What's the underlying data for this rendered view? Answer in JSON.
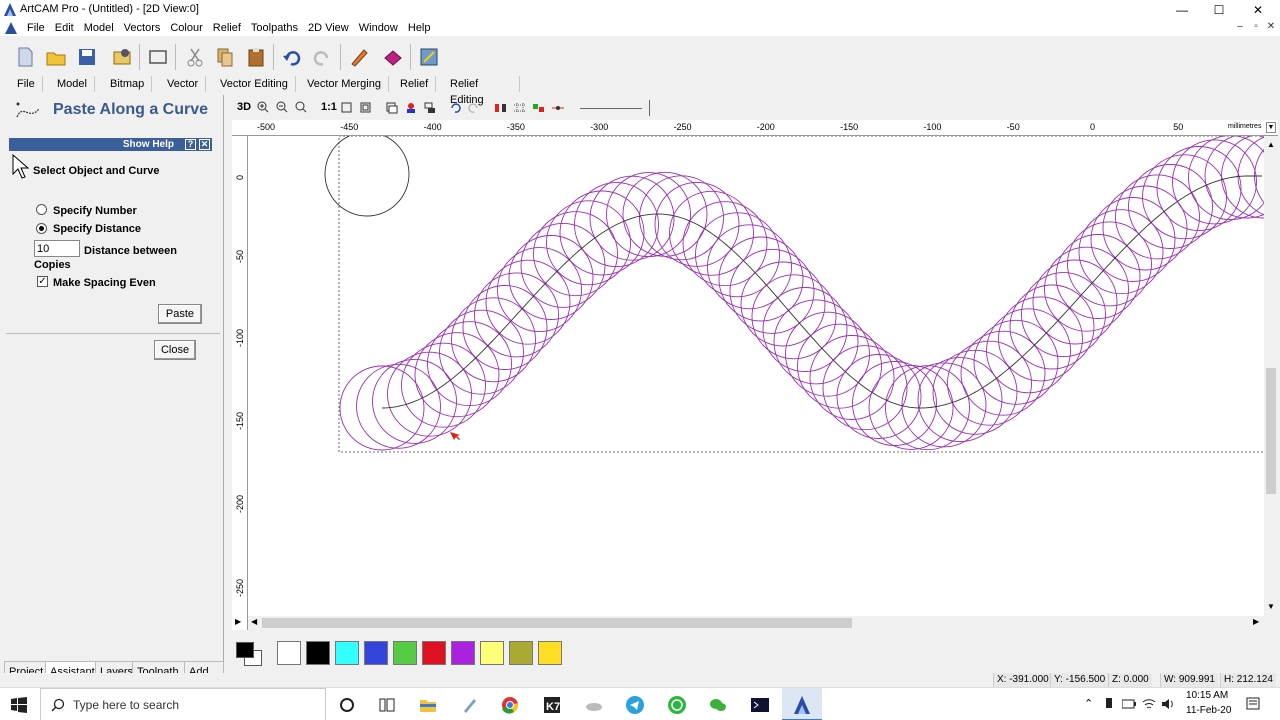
{
  "window": {
    "title": "ArtCAM Pro - (Untitled) - [2D View:0]",
    "controls": {
      "minimize": "—",
      "maximize": "☐",
      "close": "✕"
    }
  },
  "menubar": {
    "items": [
      "File",
      "Edit",
      "Model",
      "Vectors",
      "Colour",
      "Relief",
      "Toolpaths",
      "2D View",
      "Window",
      "Help"
    ],
    "mdi": {
      "minimize": "–",
      "restore": "▫",
      "close": "✕"
    }
  },
  "toolbar": {
    "icons": [
      "new-file-icon",
      "open-folder-icon",
      "save-disk-icon",
      "import-image-icon",
      "frame-icon",
      "cut-icon",
      "copy-icon",
      "paste-icon",
      "undo-icon",
      "redo-icon",
      "edit-pencil-icon",
      "eraser-icon",
      "wizard-icon"
    ]
  },
  "tabs": [
    "File",
    "Model",
    "Bitmap",
    "Vector",
    "Vector Editing",
    "Vector Merging",
    "Relief",
    "Relief Editing"
  ],
  "panel": {
    "title": "Paste Along a Curve",
    "help_label": "Show Help",
    "help_q": "?",
    "help_x": "✕",
    "instruction": "Select Object and Curve",
    "specify_number": "Specify Number",
    "specify_distance": "Specify Distance",
    "distance_value": "10",
    "distance_label": "Distance between",
    "copies_label": "Copies",
    "make_even": "Make Spacing Even",
    "make_even_checked": true,
    "mode": "distance",
    "paste_btn": "Paste",
    "close_btn": "Close"
  },
  "bottom_tabs": [
    "Project",
    "Assistant",
    "Layers",
    "Toolpath..",
    "Add In"
  ],
  "view_toolbar": {
    "three_d": "3D",
    "one_to_one": "1:1"
  },
  "ruler": {
    "top": [
      "-500",
      "-450",
      "-400",
      "-350",
      "-300",
      "-250",
      "-200",
      "-150",
      "-100",
      "-50",
      "0",
      "50"
    ],
    "left": [
      "0",
      "-50",
      "-100",
      "-150",
      "-200",
      "-250"
    ],
    "units": "millimetres"
  },
  "palette": [
    "#000000",
    "#ffffff",
    "#000000",
    "#33ffff",
    "#3344dd",
    "#55cc44",
    "#dd1122",
    "#aa22dd",
    "#ffff77",
    "#aaaa33",
    "#ffdd22"
  ],
  "status": {
    "x": "X: -391.000",
    "y": "Y: -156.500",
    "z": "Z: 0.000",
    "w": "W: 909.991",
    "h": "H: 212.124"
  },
  "taskbar": {
    "search_placeholder": "Type here to search",
    "time": "10:15 AM",
    "date": "11-Feb-20"
  },
  "colors": {
    "curve": "#9b2fb5",
    "title_blue": "#3a5a8c",
    "help_bar": "#3a5f9a"
  }
}
